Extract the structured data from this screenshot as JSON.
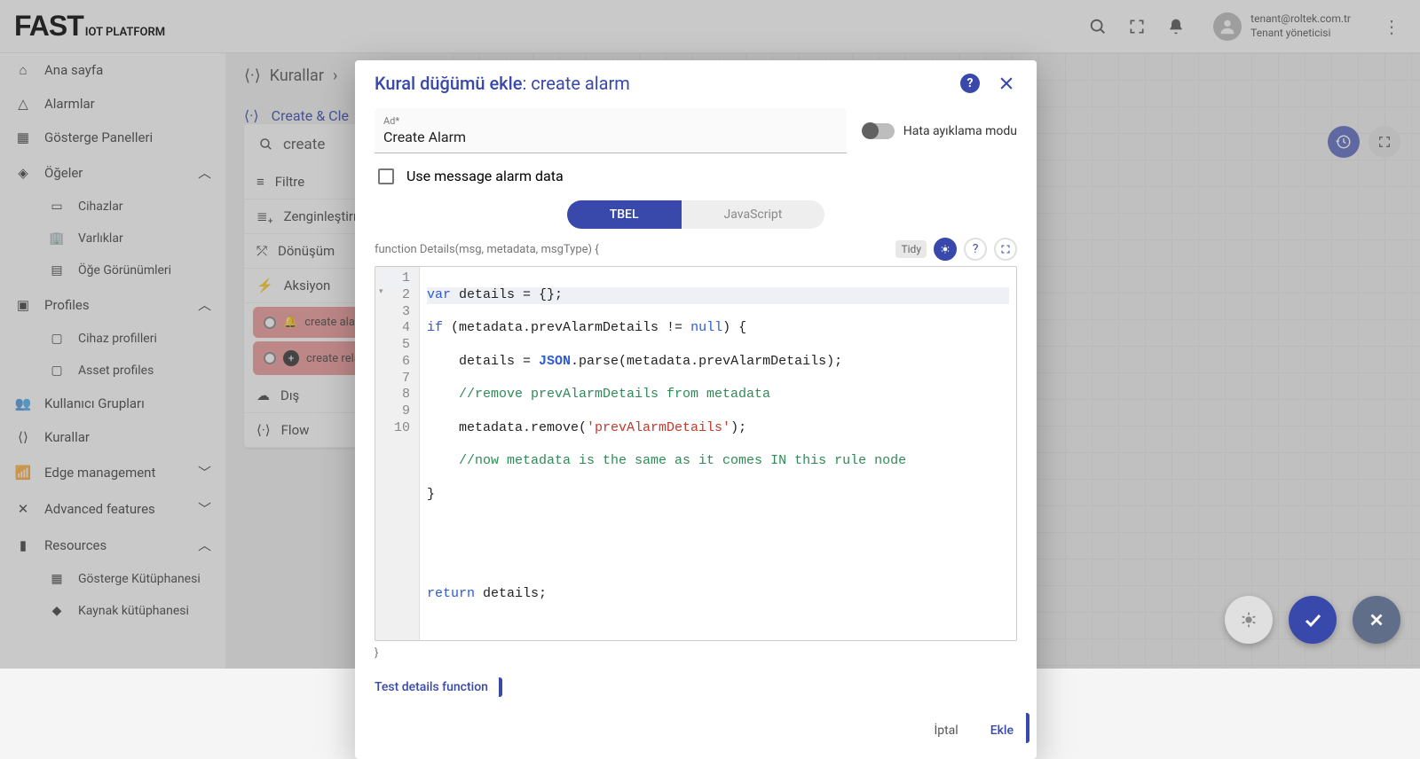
{
  "header": {
    "logo_main": "FAST",
    "logo_sub": "IOT PLATFORM",
    "user_email": "tenant@roltek.com.tr",
    "user_role": "Tenant yöneticisi"
  },
  "sidebar": {
    "items": [
      {
        "label": "Ana sayfa"
      },
      {
        "label": "Alarmlar"
      },
      {
        "label": "Gösterge Panelleri"
      },
      {
        "label": "Öğeler",
        "expandable": true
      },
      {
        "label": "Cihazlar",
        "sub": true
      },
      {
        "label": "Varlıklar",
        "sub": true
      },
      {
        "label": "Öğe Görünümleri",
        "sub": true
      },
      {
        "label": "Profiles",
        "expandable": true
      },
      {
        "label": "Cihaz profilleri",
        "sub": true
      },
      {
        "label": "Asset profiles",
        "sub": true
      },
      {
        "label": "Kullanıcı Grupları"
      },
      {
        "label": "Kurallar"
      },
      {
        "label": "Edge management",
        "expandable": true,
        "collapsed": true
      },
      {
        "label": "Advanced features",
        "expandable": true,
        "collapsed": true
      },
      {
        "label": "Resources",
        "expandable": true
      },
      {
        "label": "Gösterge Kütüphanesi",
        "sub": true
      },
      {
        "label": "Kaynak kütüphanesi",
        "sub": true
      }
    ]
  },
  "breadcrumb": {
    "rules": "Kurallar",
    "sub": "Create & Cle"
  },
  "searchValue": "create",
  "nodeTypes": {
    "filter": "Filtre",
    "enrich": "Zenginleştirm",
    "transform": "Dönüşüm",
    "action": "Aksiyon",
    "chip1": "create alarm",
    "chip2": "create relation",
    "external": "Dış",
    "flow": "Flow"
  },
  "modal": {
    "title_prefix": "Kural düğümü ekle",
    "title_node": ": create alarm",
    "name_label": "Ad*",
    "name_value": "Create Alarm",
    "debug_label": "Hata ayıklama modu",
    "checkbox_label": "Use message alarm data",
    "tab_tbel": "TBEL",
    "tab_js": "JavaScript",
    "func_sig": "function Details(msg, metadata, msgType) {",
    "tidy": "Tidy",
    "code": {
      "l1": {
        "kw": "var",
        "rest": " details = {};"
      },
      "l2": {
        "kw": "if",
        "rest": " (metadata.prevAlarmDetails != ",
        "nullkw": "null",
        "rest2": ") {"
      },
      "l3": {
        "indent": "    details = ",
        "cls": "JSON",
        "rest": ".parse(metadata.prevAlarmDetails);"
      },
      "l4": {
        "cmt": "    //remove prevAlarmDetails from metadata"
      },
      "l5": {
        "indent": "    metadata.remove(",
        "str": "'prevAlarmDetails'",
        "rest": ");"
      },
      "l6": {
        "cmt": "    //now metadata is the same as it comes IN this rule node"
      },
      "l7": {
        "text": "}"
      },
      "l8": {
        "text": ""
      },
      "l9": {
        "text": ""
      },
      "l10": {
        "kw": "return",
        "rest": " details;"
      }
    },
    "closing": "}",
    "test_link": "Test details function",
    "cancel": "İptal",
    "add": "Ekle"
  }
}
